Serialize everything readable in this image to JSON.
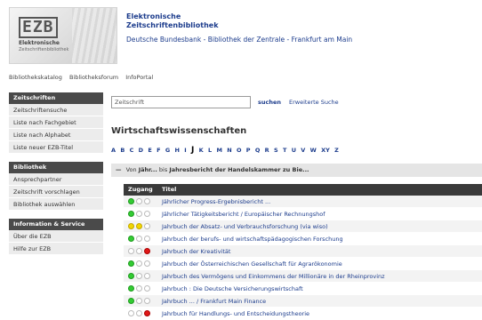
{
  "header": {
    "logo_text": "EZB",
    "logo_sub1": "Elektronische",
    "logo_sub2": "Zeitschriftenbibliothek",
    "title_line1": "Elektronische",
    "title_line2": "Zeitschriftenbibliothek",
    "institution": "Deutsche Bundesbank - Bibliothek der Zentrale - Frankfurt am Main"
  },
  "topnav": [
    "Bibliothekskatalog",
    "Bibliotheksforum",
    "InfoPortal"
  ],
  "sidebar": {
    "groups": [
      {
        "heading": "Zeitschriften",
        "items": [
          "Zeitschriftensuche",
          "Liste nach Fachgebiet",
          "Liste nach Alphabet",
          "Liste neuer EZB-Titel"
        ]
      },
      {
        "heading": "Bibliothek",
        "items": [
          "Ansprechpartner",
          "Zeitschrift vorschlagen",
          "Bibliothek auswählen"
        ]
      },
      {
        "heading": "Information & Service",
        "items": [
          "Über die EZB",
          "Hilfe zur EZB"
        ]
      }
    ]
  },
  "search": {
    "value": "Zeitschrift",
    "button_label": "suchen",
    "advanced_label": "Erweiterte Suche"
  },
  "section_title": "Wirtschaftswissenschaften",
  "alphabet": [
    "A",
    "B",
    "C",
    "D",
    "E",
    "F",
    "G",
    "H",
    "I",
    "J",
    "K",
    "L",
    "M",
    "N",
    "O",
    "P",
    "Q",
    "R",
    "S",
    "T",
    "U",
    "V",
    "W",
    "XY",
    "Z"
  ],
  "alphabet_current": "J",
  "range": {
    "toggle": "—",
    "prefix": "Von",
    "from": "Jähr...",
    "middle": "bis",
    "to": "Jahresbericht der Handelskammer zu Bie..."
  },
  "table": {
    "headers": {
      "access": "Zugang",
      "title": "Titel"
    },
    "rows": [
      {
        "lights": [
          "green",
          "off",
          "off"
        ],
        "title": "Jährlicher Progress-Ergebnisbericht ..."
      },
      {
        "lights": [
          "green",
          "off",
          "off"
        ],
        "title": "Jährlicher Tätigkeitsbericht / Europäischer Rechnungshof"
      },
      {
        "lights": [
          "yellow",
          "yellow",
          "off"
        ],
        "title": "Jahrbuch der Absatz- und Verbrauchsforschung (via wiso)"
      },
      {
        "lights": [
          "green",
          "off",
          "off"
        ],
        "title": "Jahrbuch der berufs- und wirtschaftspädagogischen Forschung"
      },
      {
        "lights": [
          "off",
          "off",
          "red"
        ],
        "title": "Jahrbuch der Kreativität"
      },
      {
        "lights": [
          "green",
          "off",
          "off"
        ],
        "title": "Jahrbuch der Österreichischen Gesellschaft für Agrarökonomie"
      },
      {
        "lights": [
          "green",
          "off",
          "off"
        ],
        "title": "Jahrbuch des Vermögens und Einkommens der Millionäre in der Rheinprovinz"
      },
      {
        "lights": [
          "green",
          "off",
          "off"
        ],
        "title": "Jahrbuch : Die Deutsche Versicherungswirtschaft"
      },
      {
        "lights": [
          "green",
          "off",
          "off"
        ],
        "title": "Jahrbuch ... / Frankfurt Main Finance"
      },
      {
        "lights": [
          "off",
          "off",
          "red"
        ],
        "title": "Jahrbuch für Handlungs- und Entscheidungstheorie"
      }
    ]
  },
  "colors": {
    "link": "#1c3c8c",
    "sidebar_head": "#4a4a4a",
    "table_head": "#3a3a3a",
    "green": "#33cc33",
    "yellow": "#f2d500",
    "red": "#e01818"
  }
}
